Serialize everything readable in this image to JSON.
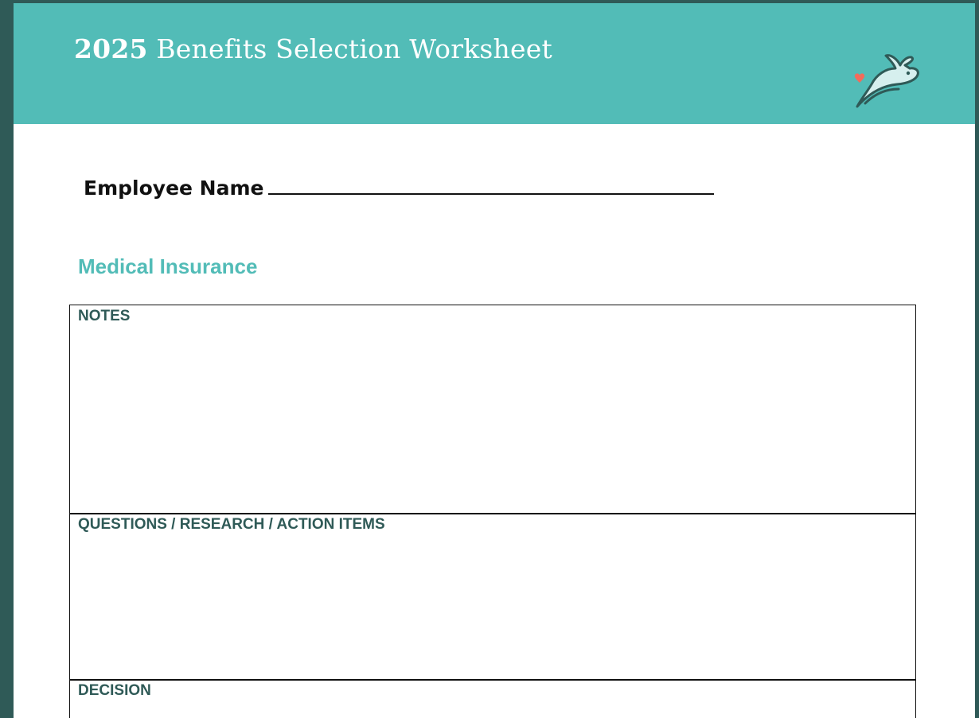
{
  "header": {
    "year": "2025",
    "title": "Benefits Selection Worksheet",
    "logo_icon": "rabbit-with-heart-icon",
    "accent_color": "#52bcb7",
    "frame_color": "#2f5a57"
  },
  "form": {
    "employee_name_label": "Employee Name",
    "employee_name_value": ""
  },
  "section": {
    "title": "Medical Insurance",
    "boxes": {
      "notes": "NOTES",
      "questions": "QUESTIONS / RESEARCH / ACTION ITEMS",
      "decision": "DECISION"
    }
  }
}
